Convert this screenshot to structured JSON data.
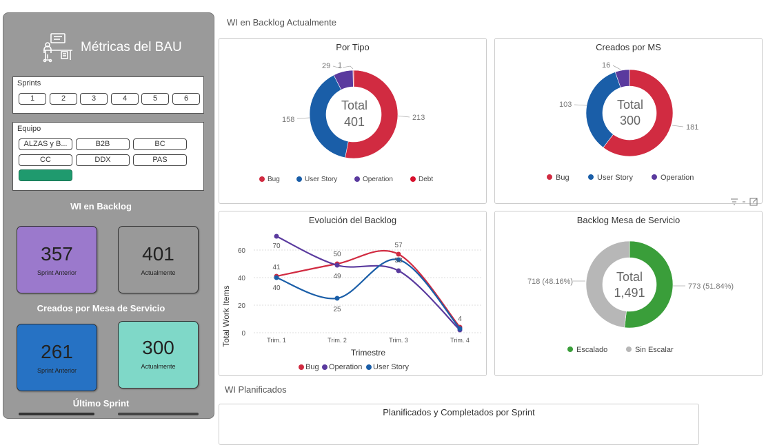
{
  "sidebar": {
    "title": "Métricas del BAU",
    "sprints": {
      "title": "Sprints",
      "items": [
        "1",
        "2",
        "3",
        "4",
        "5",
        "6"
      ]
    },
    "equipo": {
      "title": "Equipo",
      "items": [
        "ALZAS y B...",
        "B2B",
        "BC",
        "CC",
        "DDX",
        "PAS",
        ""
      ]
    },
    "wi_backlog_heading": "WI en Backlog",
    "wi_prev_value": "357",
    "wi_prev_label": "Sprint Anterior",
    "wi_curr_value": "401",
    "wi_curr_label": "Actualmente",
    "creados_heading": "Creados por Mesa de Servicio",
    "creados_prev_value": "261",
    "creados_prev_label": "Sprint Anterior",
    "creados_curr_value": "300",
    "creados_curr_label": "Actualmente",
    "ultimo_heading": "Último Sprint"
  },
  "sections": {
    "backlog_actual": "WI en Backlog Actualmente",
    "planificados": "WI Planificados"
  },
  "cards": {
    "por_tipo": {
      "title": "Por Tipo",
      "center_label": "Total",
      "center_value": "401",
      "labels": [
        "213",
        "158",
        "29",
        "1"
      ],
      "legend": [
        "Bug",
        "User Story",
        "Operation",
        "Debt"
      ]
    },
    "creados_ms": {
      "title": "Creados por MS",
      "center_label": "Total",
      "center_value": "300",
      "labels": [
        "181",
        "103",
        "16"
      ],
      "legend": [
        "Bug",
        "User Story",
        "Operation"
      ]
    },
    "evolucion": {
      "title": "Evolución del Backlog",
      "legend": [
        "Bug",
        "Operation",
        "User Story"
      ]
    },
    "mesa": {
      "title": "Backlog Mesa de Servicio",
      "center_label": "Total",
      "center_value": "1,491",
      "labels": [
        "773 (51.84%)",
        "718 (48.16%)"
      ],
      "legend": [
        "Escalado",
        "Sin Escalar"
      ]
    },
    "planificados": {
      "title": "Planificados y Completados por Sprint"
    }
  },
  "colors": {
    "bug": "#d12b41",
    "user_story": "#1a5ea8",
    "operation": "#5a3a9e",
    "debt": "#d8122e",
    "escalado": "#3a9e3a",
    "sin_escalar": "#b7b7b7",
    "kpi_purple": "#9b79cc",
    "kpi_gray": "#999999",
    "kpi_blue": "#2672c4",
    "kpi_teal": "#7fd8c8"
  },
  "chart_data": [
    {
      "type": "pie",
      "title": "Por Tipo",
      "categories": [
        "Bug",
        "User Story",
        "Operation",
        "Debt"
      ],
      "values": [
        213,
        158,
        29,
        1
      ],
      "total": 401
    },
    {
      "type": "pie",
      "title": "Creados por MS",
      "categories": [
        "Bug",
        "User Story",
        "Operation"
      ],
      "values": [
        181,
        103,
        16
      ],
      "total": 300
    },
    {
      "type": "line",
      "title": "Evolución del Backlog",
      "xlabel": "Trimestre",
      "ylabel": "Total Work Items",
      "categories": [
        "Trim. 1",
        "Trim. 2",
        "Trim. 3",
        "Trim. 4"
      ],
      "ylim": [
        0,
        70
      ],
      "yticks": [
        0,
        20,
        40,
        60
      ],
      "series": [
        {
          "name": "Bug",
          "values": [
            41,
            50,
            57,
            4
          ]
        },
        {
          "name": "Operation",
          "values": [
            70,
            49,
            45,
            2
          ]
        },
        {
          "name": "User Story",
          "values": [
            40,
            25,
            53,
            3
          ]
        }
      ],
      "data_labels": [
        {
          "value": "70"
        },
        {
          "value": "41"
        },
        {
          "value": "40"
        },
        {
          "value": "50"
        },
        {
          "value": "49"
        },
        {
          "value": "25"
        },
        {
          "value": "57"
        },
        {
          "value": "53"
        },
        {
          "value": "4"
        }
      ],
      "legend": "bottom"
    },
    {
      "type": "pie",
      "title": "Backlog Mesa de Servicio",
      "categories": [
        "Escalado",
        "Sin Escalar"
      ],
      "values": [
        773,
        718
      ],
      "total": 1491
    }
  ]
}
